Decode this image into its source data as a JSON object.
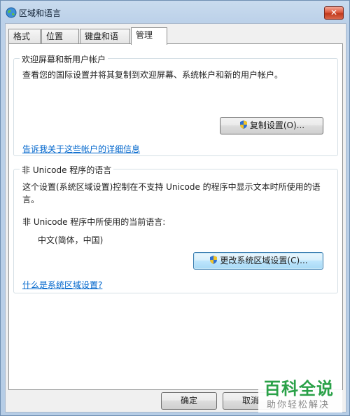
{
  "window": {
    "title": "区域和语言",
    "close_label": "✕"
  },
  "tabs": [
    {
      "label": "格式",
      "active": false
    },
    {
      "label": "位置",
      "active": false
    },
    {
      "label": "键盘和语言",
      "active": false
    },
    {
      "label": "管理",
      "active": true
    }
  ],
  "welcome_group": {
    "legend": "欢迎屏幕和新用户帐户",
    "description": "查看您的国际设置并将其复制到欢迎屏幕、系统帐户和新的用户帐户。",
    "copy_button": "复制设置(O)...",
    "link": "告诉我关于这些帐户的详细信息"
  },
  "unicode_group": {
    "legend": "非 Unicode 程序的语言",
    "description": "这个设置(系统区域设置)控制在不支持 Unicode 的程序中显示文本时所使用的语言。",
    "current_label": "非 Unicode 程序中所使用的当前语言:",
    "current_value": "中文(简体，中国)",
    "change_button": "更改系统区域设置(C)...",
    "link": "什么是系统区域设置?"
  },
  "footer": {
    "ok_button": "确定",
    "cancel_button": "取消"
  },
  "watermark": {
    "title": "百科全说",
    "subtitle": "助你轻松解决"
  },
  "colors": {
    "link": "#0066cc",
    "watermark_green": "#2aa148",
    "close_red": "#c0391c"
  }
}
